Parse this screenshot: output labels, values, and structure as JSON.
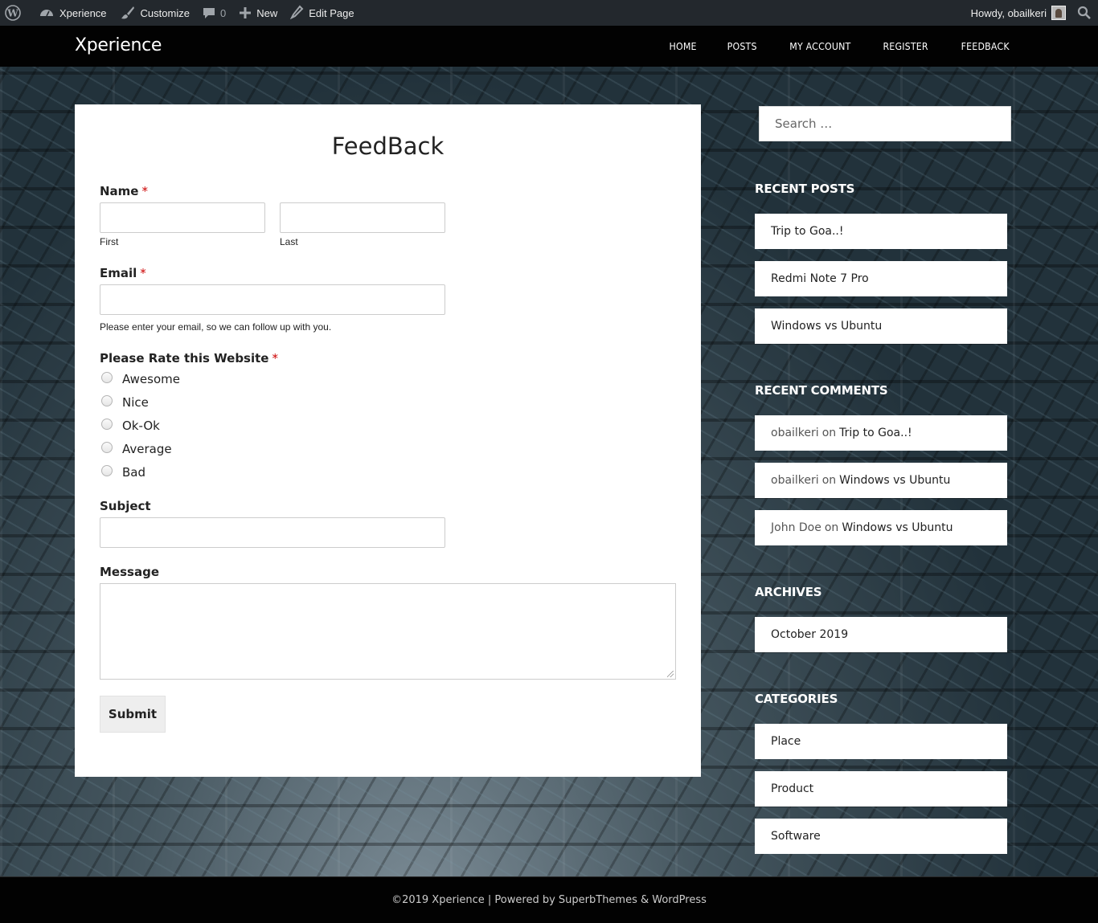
{
  "admin_bar": {
    "site_name": "Xperience",
    "customize": "Customize",
    "comments_count": "0",
    "new_label": "New",
    "edit_page": "Edit Page",
    "howdy": "Howdy, obailkeri"
  },
  "header": {
    "site_title": "Xperience",
    "nav": [
      "HOME",
      "POSTS",
      "MY ACCOUNT",
      "REGISTER",
      "FEEDBACK"
    ]
  },
  "form": {
    "title": "FeedBack",
    "name_label": "Name",
    "required_mark": "*",
    "first_label": "First",
    "last_label": "Last",
    "email_label": "Email",
    "email_desc": "Please enter your email, so we can follow up with you.",
    "rating_label": "Please Rate this Website",
    "rating_options": [
      "Awesome",
      "Nice",
      "Ok-Ok",
      "Average",
      "Bad"
    ],
    "subject_label": "Subject",
    "message_label": "Message",
    "submit_label": "Submit"
  },
  "sidebar": {
    "search_placeholder": "Search …",
    "recent_posts_title": "RECENT POSTS",
    "recent_posts": [
      "Trip to Goa..!",
      "Redmi Note 7 Pro",
      "Windows vs Ubuntu"
    ],
    "recent_comments_title": "RECENT COMMENTS",
    "recent_comments": [
      {
        "author": "obailkeri",
        "on": "on",
        "post": "Trip to Goa..!"
      },
      {
        "author": "obailkeri",
        "on": "on",
        "post": "Windows vs Ubuntu"
      },
      {
        "author": "John Doe",
        "on": "on",
        "post": "Windows vs Ubuntu"
      }
    ],
    "archives_title": "ARCHIVES",
    "archives": [
      "October 2019"
    ],
    "categories_title": "CATEGORIES",
    "categories": [
      "Place",
      "Product",
      "Software"
    ]
  },
  "footer": {
    "text": "©2019 Xperience | Powered by SuperbThemes & WordPress"
  },
  "colors": {
    "admin_bar_bg": "#23282d",
    "header_bg": "#020202",
    "required": "#cc0000"
  }
}
